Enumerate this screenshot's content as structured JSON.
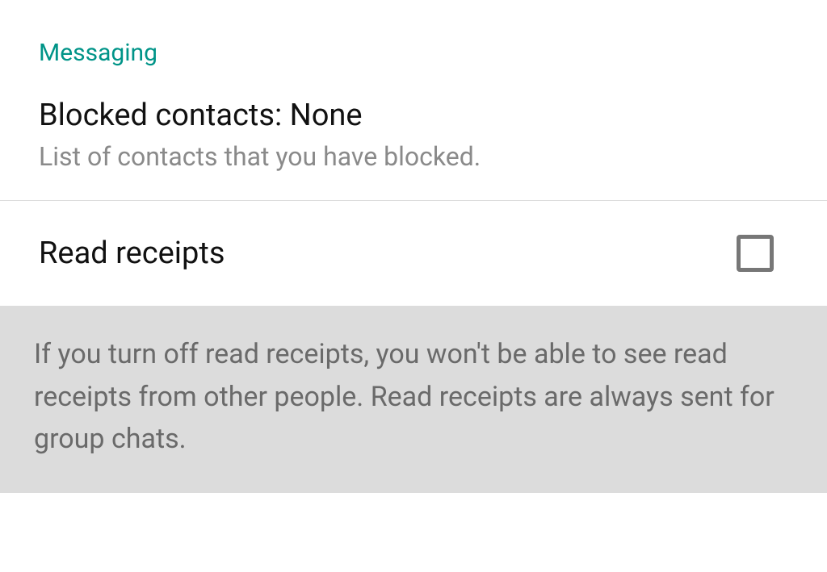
{
  "section": {
    "header": "Messaging"
  },
  "blocked_contacts": {
    "title": "Blocked contacts: None",
    "subtitle": "List of contacts that you have blocked."
  },
  "read_receipts": {
    "label": "Read receipts",
    "checked": false,
    "info": "If you turn off read receipts, you won't be able to see read receipts from other people. Read receipts are always sent for group chats."
  }
}
